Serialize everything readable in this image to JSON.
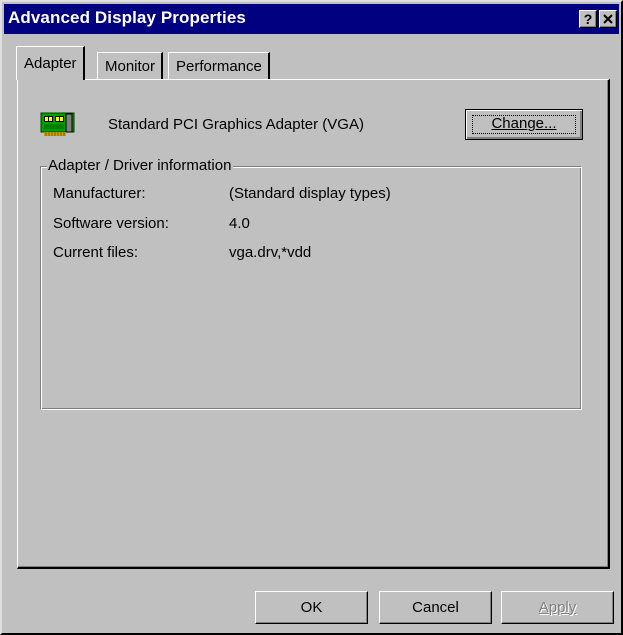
{
  "window": {
    "title": "Advanced Display Properties",
    "help_button": "?",
    "close_button": "✕"
  },
  "tabs": [
    {
      "label": "Adapter",
      "active": true
    },
    {
      "label": "Monitor",
      "active": false
    },
    {
      "label": "Performance",
      "active": false
    }
  ],
  "adapter": {
    "icon": "display-adapter-card-icon",
    "name": "Standard PCI Graphics Adapter (VGA)",
    "change_button": "Change..."
  },
  "driver_info": {
    "legend": "Adapter / Driver information",
    "rows": [
      {
        "label": "Manufacturer:",
        "value": "(Standard display types)"
      },
      {
        "label": "Software version:",
        "value": "4.0"
      },
      {
        "label": "Current files:",
        "value": "vga.drv,*vdd"
      }
    ]
  },
  "buttons": {
    "ok": "OK",
    "cancel": "Cancel",
    "apply": "Apply",
    "apply_enabled": false
  },
  "colors": {
    "title_bar": "#000080",
    "face": "#c0c0c0",
    "icon_green": "#00a000"
  }
}
